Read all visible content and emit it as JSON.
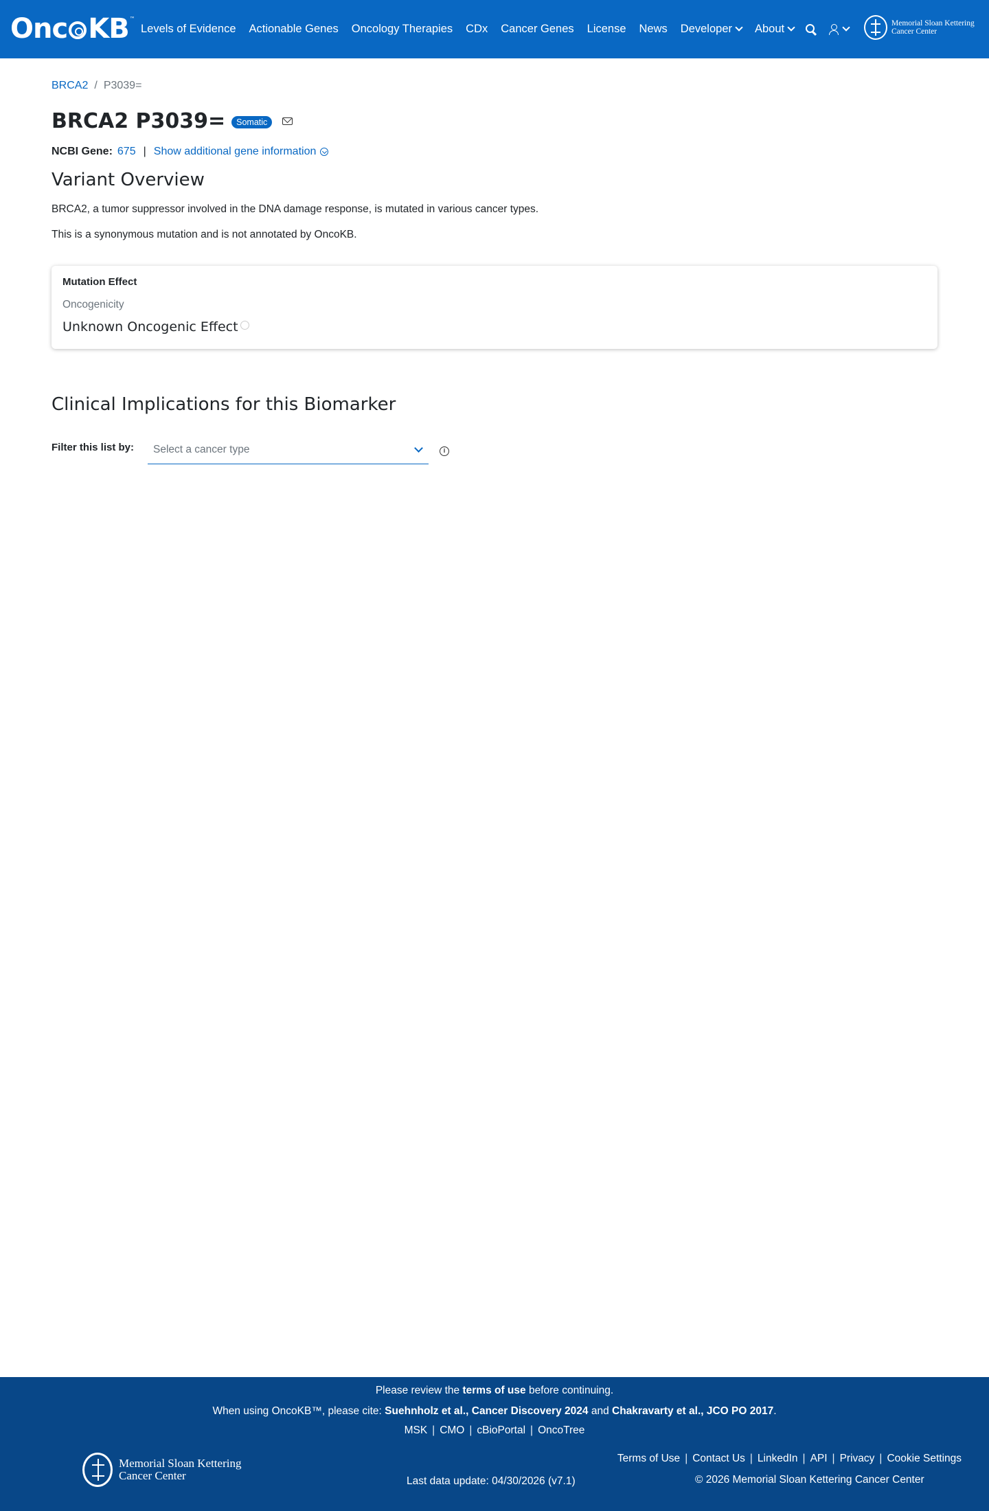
{
  "nav": {
    "logo_text_1": "Onc",
    "logo_text_2": "KB",
    "logo_tm": "™",
    "links": [
      "Levels of Evidence",
      "Actionable Genes",
      "Oncology Therapies",
      "CDx",
      "Cancer Genes",
      "License",
      "News"
    ],
    "developer": "Developer",
    "about": "About",
    "msk_line1": "Memorial Sloan Kettering",
    "msk_line2": "Cancer Center"
  },
  "breadcrumb": {
    "gene": "BRCA2",
    "sep": "/",
    "variant": "P3039="
  },
  "header": {
    "title": "BRCA2 P3039=",
    "badge": "Somatic",
    "ncbi_label": "NCBI Gene:",
    "ncbi_id": "675",
    "ncbi_sep": "|",
    "show_more": "Show additional gene information"
  },
  "overview": {
    "heading": "Variant Overview",
    "summary": "BRCA2, a tumor suppressor involved in the DNA damage response, is mutated in various cancer types.",
    "note": "This is a synonymous mutation and is not annotated by OncoKB."
  },
  "mutation_card": {
    "title": "Mutation Effect",
    "label": "Oncogenicity",
    "value": "Unknown Oncogenic Effect"
  },
  "clinical": {
    "heading": "Clinical Implications for this Biomarker",
    "filter_label": "Filter this list by:",
    "select_placeholder": "Select a cancer type",
    "info": "i"
  },
  "footer": {
    "terms_pre": "Please review the ",
    "terms_link": "terms of use",
    "terms_post": " before continuing.",
    "cite_pre": "When using OncoKB™, please cite: ",
    "cite_1": "Suehnholz et al., Cancer Discovery 2024",
    "cite_and": " and ",
    "cite_2": "Chakravarty et al., JCO PO 2017",
    "cite_end": ".",
    "links": [
      "MSK",
      "CMO",
      "cBioPortal",
      "OncoTree"
    ],
    "msk_line1": "Memorial Sloan Kettering",
    "msk_line2": "Cancer Center",
    "last_update": "Last data update: 04/30/2026 (v7.1)",
    "right_links": [
      "Terms of Use",
      "Contact Us",
      "LinkedIn",
      "API",
      "Privacy",
      "Cookie Settings"
    ],
    "copyright": "© 2026 Memorial Sloan Kettering Cancer Center"
  }
}
